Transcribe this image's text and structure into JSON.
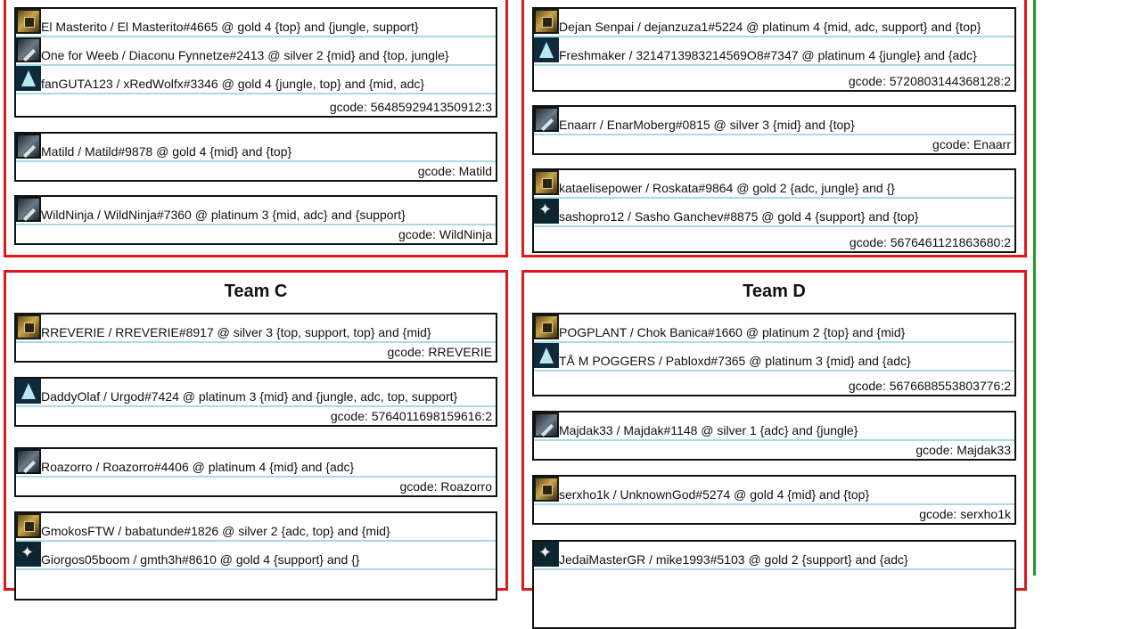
{
  "colors": {
    "team_border": "#e0191b",
    "divider": "#1f9a2a",
    "underline": "#a9dbe3"
  },
  "teams": [
    {
      "title": "",
      "groups": [
        {
          "players": [
            {
              "text": "El Masterito / El Masterito#4665 @ gold 4 {top} and {jungle, support}",
              "icon": "gold-rank-icon"
            },
            {
              "text": "One for Weeb / Diaconu Fynnetze#2413 @ silver 2 {mid} and {top, jungle}",
              "icon": "silver-rank-icon"
            },
            {
              "text": "fanGUTA123 / xRedWolfx#3346 @ gold 4 {jungle, top} and {mid, adc}",
              "icon": "platinum-rank-icon"
            }
          ],
          "gcode": "gcode: 5648592941350912:3"
        },
        {
          "players": [
            {
              "text": "Matild / Matild#9878 @ gold 4 {mid} and {top}",
              "icon": "silver-rank-icon"
            }
          ],
          "gcode": "gcode: Matild"
        },
        {
          "players": [
            {
              "text": "WildNinja / WildNinja#7360 @ platinum 3 {mid, adc} and {support}",
              "icon": "silver-rank-icon"
            }
          ],
          "gcode": "gcode: WildNinja"
        }
      ]
    },
    {
      "title": "",
      "groups": [
        {
          "players": [
            {
              "text": "Dejan Senpai / dejanzuza1#5224 @ platinum 4 {mid, adc, support} and {top}",
              "icon": "gold-rank-icon"
            },
            {
              "text": "Freshmaker / 3214713983214569O8#7347 @ platinum 4 {jungle} and {adc}",
              "icon": "platinum-rank-icon"
            }
          ],
          "gcode": "gcode: 5720803144368128:2"
        },
        {
          "players": [
            {
              "text": "Enaarr / EnarMoberg#0815 @ silver 3 {mid} and {top}",
              "icon": "silver-rank-icon"
            }
          ],
          "gcode": "gcode: Enaarr"
        },
        {
          "players": [
            {
              "text": "kataelisepower / Roskata#9864 @ gold 2 {adc, jungle} and {}",
              "icon": "gold-rank-icon"
            },
            {
              "text": "sashopro12 / Sasho Ganchev#8875 @ gold 4 {support} and {top}",
              "icon": "support-rank-icon"
            }
          ],
          "gcode": "gcode: 5676461121863680:2"
        }
      ]
    },
    {
      "title": "Team C",
      "groups": [
        {
          "players": [
            {
              "text": "RREVERIE / RREVERIE#8917 @ silver 3 {top, support, top} and {mid}",
              "icon": "gold-rank-icon"
            }
          ],
          "gcode": "gcode: RREVERIE"
        },
        {
          "players": [
            {
              "text": "DaddyOlaf / Urgod#7424 @ platinum 3 {mid} and {jungle, adc, top, support}",
              "icon": "platinum-rank-icon"
            }
          ],
          "gcode": "gcode: 5764011698159616:2"
        },
        {
          "players": [
            {
              "text": "Roazorro / Roazorro#4406 @ platinum 4 {mid} and {adc}",
              "icon": "silver-rank-icon"
            }
          ],
          "gcode": "gcode: Roazorro"
        },
        {
          "players": [
            {
              "text": "GmokosFTW / babatunde#1826 @ silver 2 {adc, top} and {mid}",
              "icon": "gold-rank-icon"
            },
            {
              "text": "Giorgos05boom / gmth3h#8610 @ gold 4 {support} and {}",
              "icon": "support-rank-icon"
            }
          ],
          "gcode": ""
        }
      ]
    },
    {
      "title": "Team D",
      "groups": [
        {
          "players": [
            {
              "text": "POGPLANT / Chok Banica#1660 @ platinum 2 {top} and {mid}",
              "icon": "gold-rank-icon"
            },
            {
              "text": "TÅ M POGGERS / Pabloxd#7365 @ platinum 3 {mid} and {adc}",
              "icon": "platinum-rank-icon"
            }
          ],
          "gcode": "gcode: 5676688553803776:2"
        },
        {
          "players": [
            {
              "text": "Majdak33 / Majdak#1148 @ silver 1 {adc} and {jungle}",
              "icon": "silver-rank-icon"
            }
          ],
          "gcode": "gcode: Majdak33"
        },
        {
          "players": [
            {
              "text": "serxho1k / UnknownGod#5274 @ gold 4 {mid} and {top}",
              "icon": "gold-rank-icon"
            }
          ],
          "gcode": "gcode: serxho1k"
        },
        {
          "players": [
            {
              "text": "JedaiMasterGR / mike1993#5103 @ gold 2 {support} and {adc}",
              "icon": "support-rank-icon"
            }
          ],
          "gcode": ""
        }
      ]
    }
  ]
}
